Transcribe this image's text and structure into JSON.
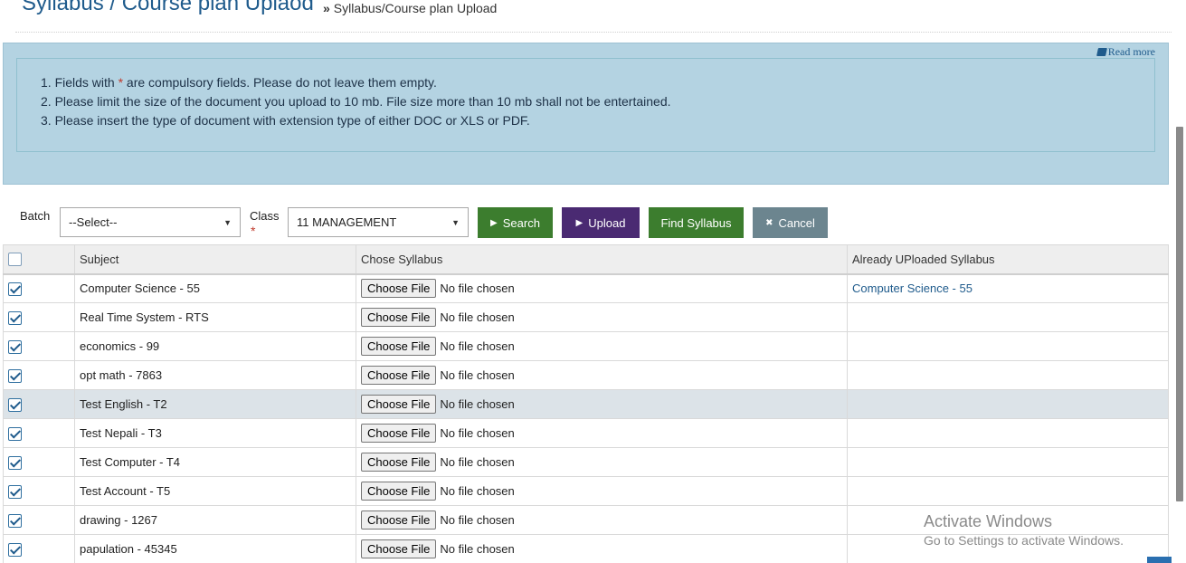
{
  "header": {
    "title": "Syllabus / Course plan Uplaod",
    "breadcrumb_sep": "»",
    "breadcrumb": "Syllabus/Course plan Upload"
  },
  "info": {
    "read_more": "Read more",
    "items": [
      {
        "pre": "1. Fields with ",
        "star": "*",
        "post": " are compulsory fields. Please do not leave them empty."
      },
      {
        "text": "2. Please limit the size of the document you upload to 10 mb. File size more than 10 mb shall not be entertained."
      },
      {
        "text": "3. Please insert the type of document with extension type of either DOC or XLS or PDF."
      }
    ]
  },
  "filters": {
    "batch_label": "Batch",
    "batch_value": "--Select--",
    "class_label": "Class",
    "class_required": "*",
    "class_value": "11 MANAGEMENT",
    "search_label": "Search",
    "upload_label": "Upload",
    "find_label": "Find Syllabus",
    "cancel_label": "Cancel"
  },
  "table": {
    "headers": [
      "Subject",
      "Chose Syllabus",
      "Already UPloaded Syllabus"
    ],
    "file_button": "Choose File",
    "no_file": "No file chosen",
    "rows": [
      {
        "subject": "Computer Science - 55",
        "uploaded": "Computer Science - 55",
        "checked": true
      },
      {
        "subject": "Real Time System - RTS",
        "uploaded": "",
        "checked": true
      },
      {
        "subject": "economics - 99",
        "uploaded": "",
        "checked": true
      },
      {
        "subject": "opt math - 7863",
        "uploaded": "",
        "checked": true
      },
      {
        "subject": "Test English - T2",
        "uploaded": "",
        "checked": true
      },
      {
        "subject": "Test Nepali - T3",
        "uploaded": "",
        "checked": true
      },
      {
        "subject": "Test Computer - T4",
        "uploaded": "",
        "checked": true
      },
      {
        "subject": "Test Account - T5",
        "uploaded": "",
        "checked": true
      },
      {
        "subject": "drawing - 1267",
        "uploaded": "",
        "checked": true
      },
      {
        "subject": "papulation - 45345",
        "uploaded": "",
        "checked": true
      }
    ]
  },
  "watermark": {
    "line1": "Activate Windows",
    "line2": "Go to Settings to activate Windows."
  }
}
